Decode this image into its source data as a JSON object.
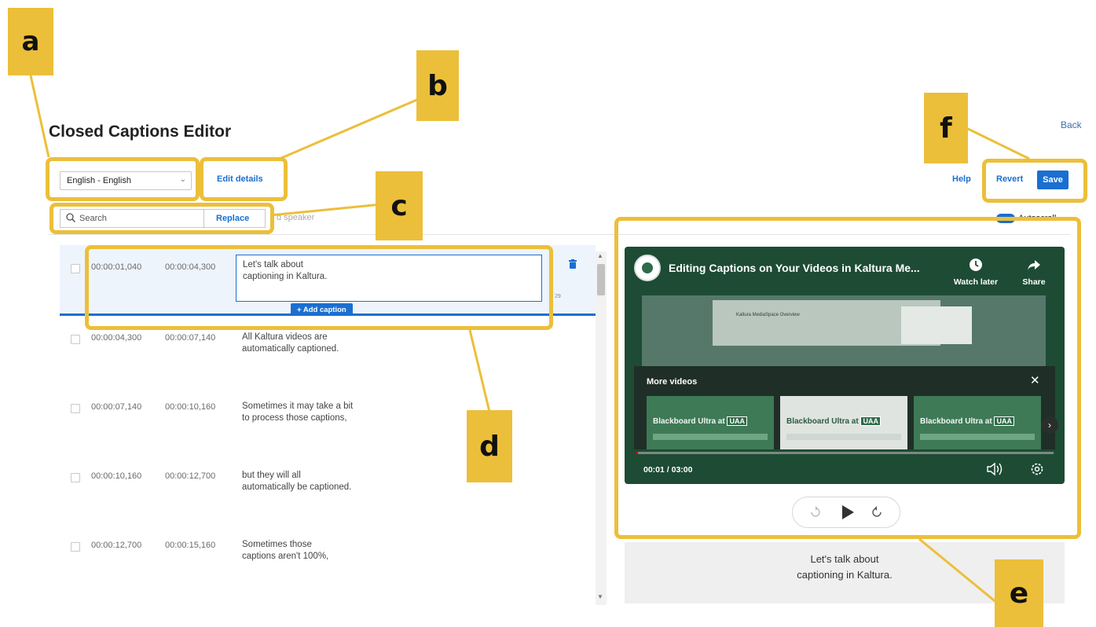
{
  "page": {
    "title": "Closed Captions Editor",
    "back_label": "Back"
  },
  "toolbar": {
    "language_value": "English - English",
    "edit_details_label": "Edit details",
    "help_label": "Help",
    "revert_label": "Revert",
    "save_label": "Save",
    "search_placeholder": "Search",
    "replace_label": "Replace",
    "speaker_label": "d speaker",
    "autoscroll_label": "Autoscroll"
  },
  "captions": [
    {
      "start": "00:00:01,040",
      "end": "00:00:04,300",
      "line1": "Let's talk about",
      "line2": "captioning in Kaltura.",
      "char_count": "29"
    },
    {
      "start": "00:00:04,300",
      "end": "00:00:07,140",
      "line1": "All Kaltura videos are",
      "line2": "automatically captioned."
    },
    {
      "start": "00:00:07,140",
      "end": "00:00:10,160",
      "line1": "Sometimes it may take a bit",
      "line2": "to process those captions,"
    },
    {
      "start": "00:00:10,160",
      "end": "00:00:12,700",
      "line1": "but they will all",
      "line2": "automatically be captioned."
    },
    {
      "start": "00:00:12,700",
      "end": "00:00:15,160",
      "line1": "Sometimes those",
      "line2": "captions aren't 100%,"
    }
  ],
  "add_caption_label": "+ Add caption",
  "player": {
    "video_title": "Editing Captions on Your Videos in Kaltura Me...",
    "watch_later_label": "Watch later",
    "share_label": "Share",
    "more_videos_label": "More videos",
    "frame_caption": "Kaltura MediaSpace Overview",
    "thumbnails": [
      {
        "title": "Blackboard Ultra at",
        "badge": "UAA"
      },
      {
        "title": "Blackboard Ultra at",
        "badge": "UAA"
      },
      {
        "title": "Blackboard Ultra at",
        "badge": "UAA"
      }
    ],
    "time_display": "00:01 / 03:00",
    "progress": 0.006
  },
  "preview": {
    "line1": "Let's talk about",
    "line2": "captioning in Kaltura."
  },
  "annotations": {
    "a": "a",
    "b": "b",
    "c": "c",
    "d": "d",
    "e": "e",
    "f": "f"
  },
  "colors": {
    "accent": "#1a6fd1",
    "annotation": "#ecbf3a",
    "player_bg": "#1d4b34"
  }
}
